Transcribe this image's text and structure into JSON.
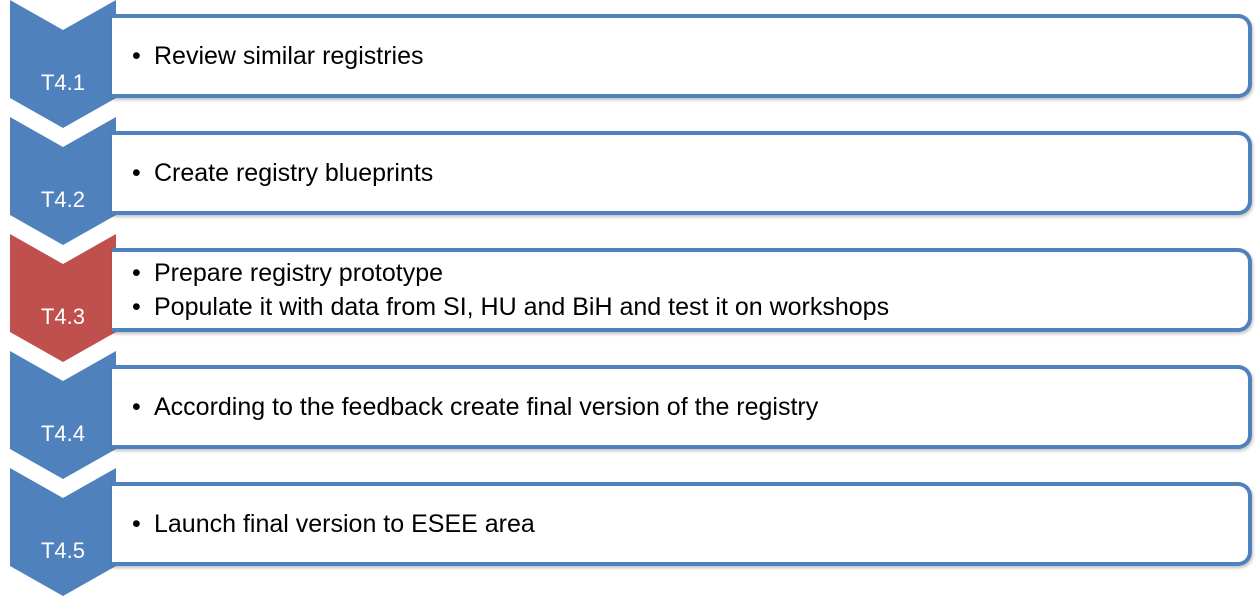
{
  "steps": [
    {
      "label": "T4.1",
      "color": "#4f81bd",
      "items": [
        "Review similar registries"
      ]
    },
    {
      "label": "T4.2",
      "color": "#4f81bd",
      "items": [
        "Create registry blueprints"
      ]
    },
    {
      "label": "T4.3",
      "color": "#c0504d",
      "items": [
        "Prepare registry prototype",
        "Populate it with data from SI, HU and BiH and test it on workshops"
      ]
    },
    {
      "label": "T4.4",
      "color": "#4f81bd",
      "items": [
        "According to the feedback create final version of the registry"
      ]
    },
    {
      "label": "T4.5",
      "color": "#4f81bd",
      "items": [
        "Launch final version to ESEE area"
      ]
    }
  ],
  "colors": {
    "chevron_default": "#4f81bd",
    "chevron_active": "#c0504d",
    "box_border": "#4f81bd"
  }
}
